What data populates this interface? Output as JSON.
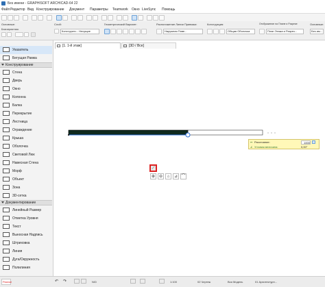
{
  "window": {
    "title": "Без имени - GRAPHISOFT ARCHICAD-64 22"
  },
  "menu": [
    "Файл",
    "Редактор",
    "Вид",
    "Конструирование",
    "Документ",
    "Параметры",
    "Teamwork",
    "Окно",
    "LiveSync",
    "Помощь"
  ],
  "infobox": {
    "basic_label": "Основные:",
    "geometry_label": "Благоприятная:",
    "layer_label": "Слой:",
    "layer_value": "Конструкти... Несущие",
    "geometry_variant_label": "Геометрический Вариант:",
    "location_label": "Расположение Линии Привязки:",
    "location_value": "Наружная Пове...",
    "structure_label": "Конструкция:",
    "structure_value": "Общая Оболочка",
    "display_label": "Отображение на Плане и Разрезе:",
    "display_value": "План Этажа и Разрез...",
    "info_label": "Основные:",
    "info_value": "Без им..."
  },
  "toolbox": {
    "items": [
      {
        "type": "item",
        "label": "Указатель",
        "icon": "arrow-pointer-icon",
        "selected": true
      },
      {
        "type": "item",
        "label": "Бегущая Рамка",
        "icon": "marquee-icon"
      },
      {
        "type": "section",
        "label": "Конструирование"
      },
      {
        "type": "item",
        "label": "Стена",
        "icon": "wall-icon"
      },
      {
        "type": "item",
        "label": "Дверь",
        "icon": "door-icon"
      },
      {
        "type": "item",
        "label": "Окно",
        "icon": "window-icon"
      },
      {
        "type": "item",
        "label": "Колонна",
        "icon": "column-icon"
      },
      {
        "type": "item",
        "label": "Балка",
        "icon": "beam-icon"
      },
      {
        "type": "item",
        "label": "Перекрытие",
        "icon": "slab-icon"
      },
      {
        "type": "item",
        "label": "Лестница",
        "icon": "stair-icon"
      },
      {
        "type": "item",
        "label": "Ограждение",
        "icon": "railing-icon"
      },
      {
        "type": "item",
        "label": "Крыша",
        "icon": "roof-icon"
      },
      {
        "type": "item",
        "label": "Оболочка",
        "icon": "shell-icon"
      },
      {
        "type": "item",
        "label": "Световой Люк",
        "icon": "skylight-icon"
      },
      {
        "type": "item",
        "label": "Навесная Стена",
        "icon": "curtain-wall-icon"
      },
      {
        "type": "item",
        "label": "Морф",
        "icon": "morph-icon"
      },
      {
        "type": "item",
        "label": "Объект",
        "icon": "object-icon"
      },
      {
        "type": "item",
        "label": "Зона",
        "icon": "zone-icon"
      },
      {
        "type": "item",
        "label": "3D-сетка",
        "icon": "mesh-icon"
      },
      {
        "type": "section",
        "label": "Документирование"
      },
      {
        "type": "item",
        "label": "Линейный Размер",
        "icon": "dimension-icon"
      },
      {
        "type": "item",
        "label": "Отметка Уровня",
        "icon": "level-dimension-icon"
      },
      {
        "type": "item",
        "label": "Текст",
        "icon": "text-icon"
      },
      {
        "type": "item",
        "label": "Выносная Надпись",
        "icon": "label-icon"
      },
      {
        "type": "item",
        "label": "Штриховка",
        "icon": "fill-icon"
      },
      {
        "type": "item",
        "label": "Линия",
        "icon": "line-icon"
      },
      {
        "type": "item",
        "label": "Дуга/Окружность",
        "icon": "arc-icon"
      },
      {
        "type": "item",
        "label": "Полилиния",
        "icon": "polyline-icon"
      }
    ],
    "more_label": "Разное"
  },
  "tabs": [
    {
      "label": "[1. 1-й этаж]",
      "icon": "floor-plan-icon",
      "active": true
    },
    {
      "label": "[3D / Все]",
      "icon": "3d-view-icon",
      "active": false
    }
  ],
  "tracker": {
    "distance_label": "Расстояние:",
    "distance_value": "1000",
    "angle_label": "Угловая величина:",
    "angle_value": "0,00°"
  },
  "statusbar": {
    "undo": "↶",
    "redo": "↷",
    "zoom_value": "N/D",
    "scale_value": "1:100",
    "layer_combo": "02 Чертеж",
    "model_view": "Вся Модель",
    "pen_set": "01 Архитектурн..."
  },
  "colors": {
    "wall_fill": "#0f2a1e",
    "selection_blue": "#2b6fd6",
    "tracker_bg": "#fff8b8"
  }
}
